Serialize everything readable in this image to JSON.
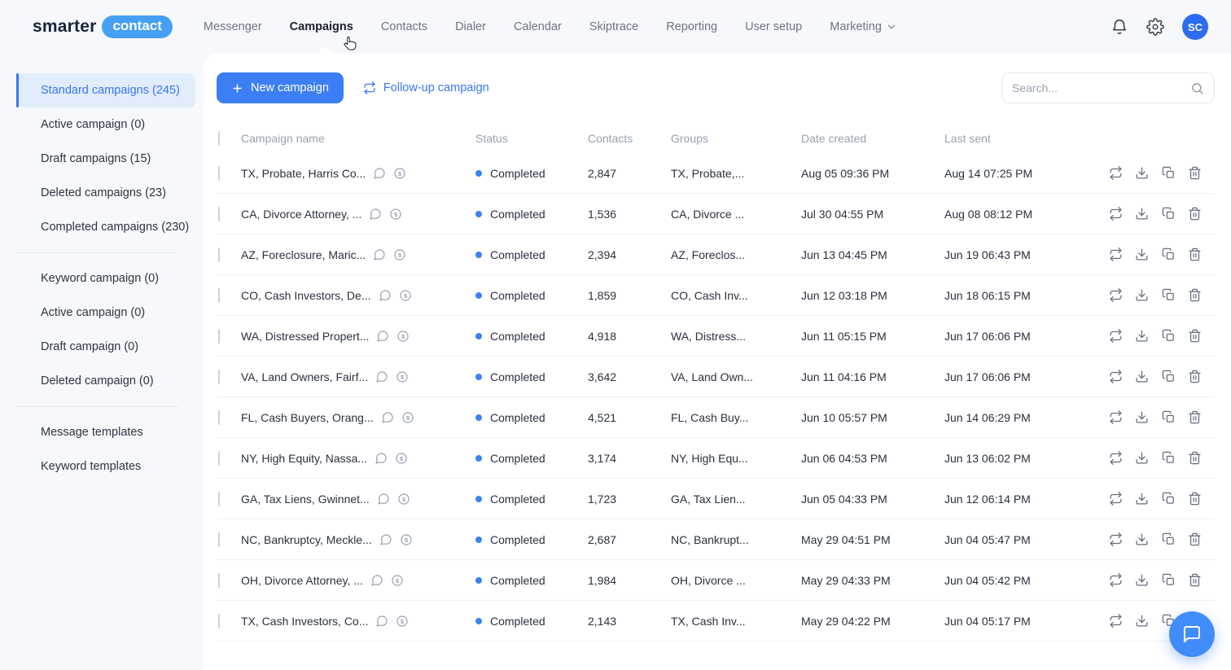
{
  "brand": {
    "logo_left": "smarter",
    "logo_badge": "contact"
  },
  "topnav": {
    "items": [
      {
        "label": "Messenger"
      },
      {
        "label": "Campaigns",
        "active": true
      },
      {
        "label": "Contacts"
      },
      {
        "label": "Dialer"
      },
      {
        "label": "Calendar"
      },
      {
        "label": "Skiptrace"
      },
      {
        "label": "Reporting"
      },
      {
        "label": "User setup"
      },
      {
        "label": "Marketing",
        "dropdown": true
      }
    ],
    "avatar_initials": "SC"
  },
  "sidebar": {
    "groups": [
      {
        "items": [
          {
            "label": "Standard campaigns (245)",
            "active": true
          },
          {
            "label": "Active campaign (0)"
          },
          {
            "label": "Draft campaigns (15)"
          },
          {
            "label": "Deleted campaigns (23)"
          },
          {
            "label": "Completed campaigns (230)"
          }
        ]
      },
      {
        "items": [
          {
            "label": "Keyword campaign (0)"
          },
          {
            "label": "Active campaign (0)"
          },
          {
            "label": "Draft campaign (0)"
          },
          {
            "label": "Deleted campaign (0)"
          }
        ]
      },
      {
        "items": [
          {
            "label": "Message templates"
          },
          {
            "label": "Keyword templates"
          }
        ]
      }
    ]
  },
  "toolbar": {
    "new_campaign_label": "New campaign",
    "followup_campaign_label": "Follow-up campaign",
    "search_placeholder": "Search..."
  },
  "table": {
    "headers": [
      "Campaign name",
      "Status",
      "Contacts",
      "Groups",
      "Date created",
      "Last sent"
    ],
    "rows": [
      {
        "name": "TX, Probate, Harris Co...",
        "status": "Completed",
        "contacts": "2,847",
        "groups": "TX, Probate,...",
        "date_created": "Aug 05 09:36 PM",
        "last_sent": "Aug 14 07:25 PM"
      },
      {
        "name": "CA, Divorce Attorney, ...",
        "status": "Completed",
        "contacts": "1,536",
        "groups": "CA, Divorce ...",
        "date_created": "Jul 30 04:55 PM",
        "last_sent": "Aug 08 08:12 PM"
      },
      {
        "name": "AZ, Foreclosure, Maric...",
        "status": "Completed",
        "contacts": "2,394",
        "groups": "AZ, Foreclos...",
        "date_created": "Jun 13 04:45 PM",
        "last_sent": "Jun 19 06:43 PM"
      },
      {
        "name": "CO, Cash Investors, De...",
        "status": "Completed",
        "contacts": "1,859",
        "groups": "CO, Cash Inv...",
        "date_created": "Jun 12 03:18 PM",
        "last_sent": "Jun 18 06:15 PM"
      },
      {
        "name": "WA, Distressed Propert...",
        "status": "Completed",
        "contacts": "4,918",
        "groups": "WA, Distress...",
        "date_created": "Jun 11 05:15 PM",
        "last_sent": "Jun 17 06:06 PM"
      },
      {
        "name": "VA, Land Owners, Fairf...",
        "status": "Completed",
        "contacts": "3,642",
        "groups": "VA, Land Own...",
        "date_created": "Jun 11 04:16 PM",
        "last_sent": "Jun 17 06:06 PM"
      },
      {
        "name": "FL, Cash Buyers, Orang...",
        "status": "Completed",
        "contacts": "4,521",
        "groups": "FL, Cash Buy...",
        "date_created": "Jun 10 05:57 PM",
        "last_sent": "Jun 14 06:29 PM"
      },
      {
        "name": "NY, High Equity, Nassa...",
        "status": "Completed",
        "contacts": "3,174",
        "groups": "NY, High Equ...",
        "date_created": "Jun 06 04:53 PM",
        "last_sent": "Jun 13 06:02 PM"
      },
      {
        "name": "GA, Tax Liens, Gwinnet...",
        "status": "Completed",
        "contacts": "1,723",
        "groups": "GA, Tax Lien...",
        "date_created": "Jun 05 04:33 PM",
        "last_sent": "Jun 12 06:14 PM"
      },
      {
        "name": "NC, Bankruptcy, Meckle...",
        "status": "Completed",
        "contacts": "2,687",
        "groups": "NC, Bankrupt...",
        "date_created": "May 29 04:51 PM",
        "last_sent": "Jun 04 05:47 PM"
      },
      {
        "name": "OH, Divorce Attorney, ...",
        "status": "Completed",
        "contacts": "1,984",
        "groups": "OH, Divorce ...",
        "date_created": "May 29 04:33 PM",
        "last_sent": "Jun 04 05:42 PM"
      },
      {
        "name": "TX, Cash Investors, Co...",
        "status": "Completed",
        "contacts": "2,143",
        "groups": "TX, Cash Inv...",
        "date_created": "May 29 04:22 PM",
        "last_sent": "Jun 04 05:17 PM"
      }
    ]
  },
  "colors": {
    "primary": "#3c7ef3",
    "accent_badge": "#45a0f4",
    "link_blue": "#3775f6",
    "status_dot": "#3b82f6",
    "page_bg": "#f7f8fb"
  }
}
